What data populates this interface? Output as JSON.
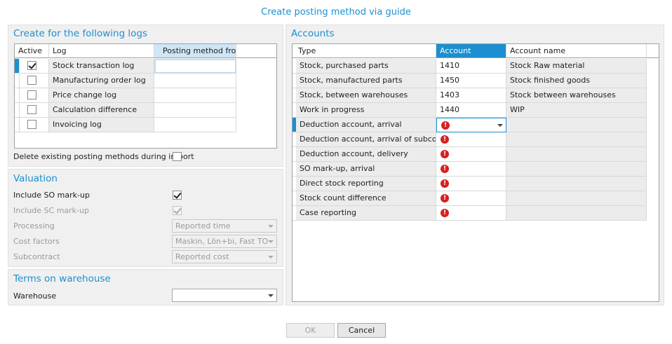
{
  "dialog": {
    "title": "Create posting method via guide"
  },
  "logs_panel": {
    "title": "Create for the following logs",
    "columns": [
      "Active",
      "Log",
      "Posting method from"
    ],
    "rows": [
      {
        "active": true,
        "log": "Stock transaction log",
        "posting_method_from": ""
      },
      {
        "active": false,
        "log": "Manufacturing order log",
        "posting_method_from": ""
      },
      {
        "active": false,
        "log": "Price change log",
        "posting_method_from": ""
      },
      {
        "active": false,
        "log": "Calculation difference",
        "posting_method_from": ""
      },
      {
        "active": false,
        "log": "Invoicing log",
        "posting_method_from": ""
      }
    ],
    "delete_existing_label": "Delete existing posting methods during import",
    "delete_existing_checked": false
  },
  "valuation_panel": {
    "title": "Valuation",
    "include_so_label": "Include SO mark-up",
    "include_so_checked": true,
    "include_sc_label": "Include SC mark-up",
    "include_sc_checked": true,
    "processing_label": "Processing",
    "processing_value": "Reported time",
    "cost_factors_label": "Cost factors",
    "cost_factors_value": "Maskin, Lön+bi, Fast TO",
    "subcontract_label": "Subcontract",
    "subcontract_value": "Reported cost"
  },
  "warehouse_panel": {
    "title": "Terms on warehouse",
    "warehouse_label": "Warehouse",
    "warehouse_value": ""
  },
  "accounts_panel": {
    "title": "Accounts",
    "columns": [
      "Type",
      "Account",
      "Account name"
    ],
    "rows": [
      {
        "type": "Stock, purchased parts",
        "account": "1410",
        "account_name": "Stock Raw material",
        "error": false
      },
      {
        "type": "Stock, manufactured parts",
        "account": "1450",
        "account_name": "Stock finished goods",
        "error": false
      },
      {
        "type": "Stock, between warehouses",
        "account": "1403",
        "account_name": "Stock between warehouses",
        "error": false
      },
      {
        "type": "Work in progress",
        "account": "1440",
        "account_name": "WIP",
        "error": false
      },
      {
        "type": "Deduction account, arrival",
        "account": "",
        "account_name": "",
        "error": true,
        "selected": true
      },
      {
        "type": "Deduction account, arrival of subcon...",
        "account": "",
        "account_name": "",
        "error": true
      },
      {
        "type": "Deduction account, delivery",
        "account": "",
        "account_name": "",
        "error": true
      },
      {
        "type": "SO mark-up, arrival",
        "account": "",
        "account_name": "",
        "error": true
      },
      {
        "type": "Direct stock reporting",
        "account": "",
        "account_name": "",
        "error": true
      },
      {
        "type": "Stock count difference",
        "account": "",
        "account_name": "",
        "error": true
      },
      {
        "type": "Case reporting",
        "account": "",
        "account_name": "",
        "error": true
      }
    ],
    "error_icon": "error-icon"
  },
  "buttons": {
    "ok_label": "OK",
    "cancel_label": "Cancel"
  },
  "colors": {
    "accent": "#1c8fd0",
    "error": "#d62020",
    "selected_header": "#cfe6f7"
  }
}
